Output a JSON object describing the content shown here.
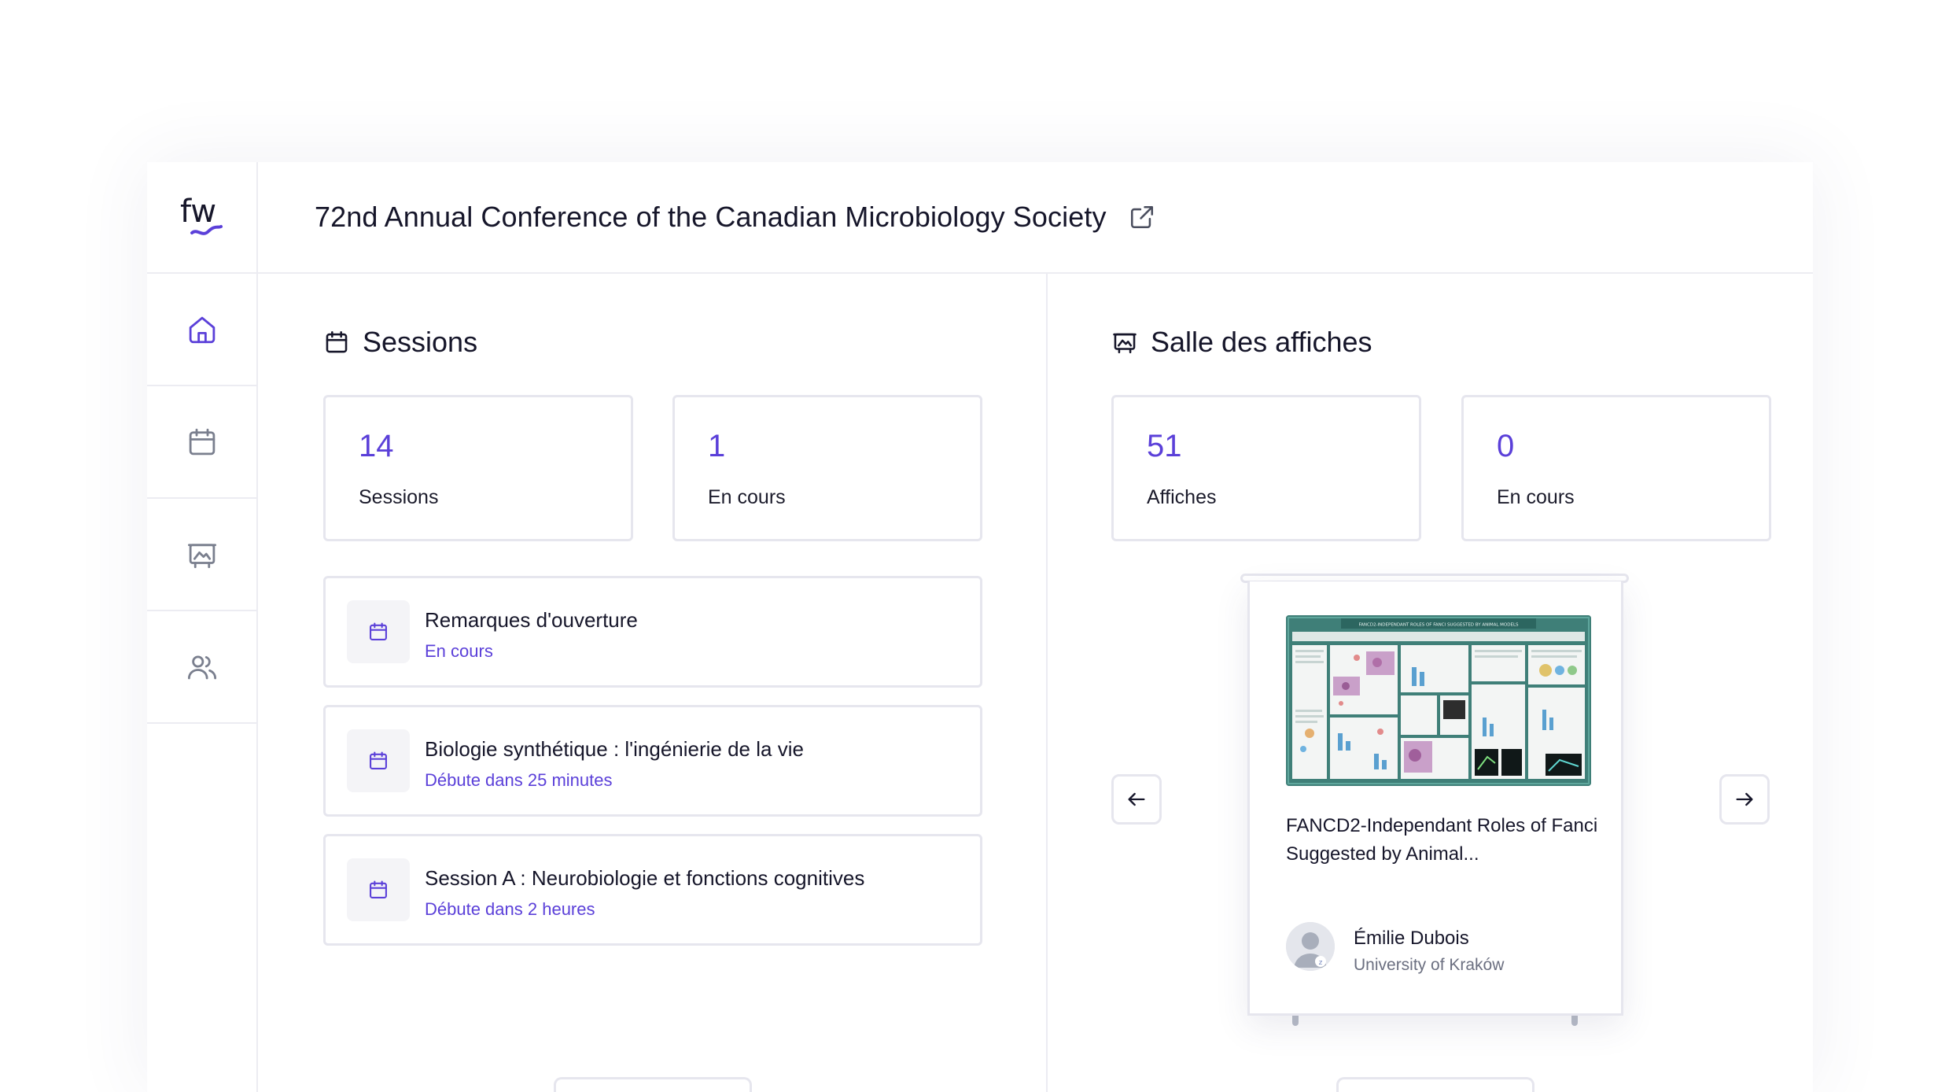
{
  "conference": {
    "title": "72nd Annual Conference of the Canadian Microbiology Society"
  },
  "brand": {
    "logo_text": "fw",
    "accent": "#5b40d9"
  },
  "sidebar": {
    "items": [
      {
        "name": "home",
        "icon": "home-icon",
        "active": true
      },
      {
        "name": "sessions",
        "icon": "calendar-icon",
        "active": false
      },
      {
        "name": "posters",
        "icon": "poster-icon",
        "active": false
      },
      {
        "name": "people",
        "icon": "users-icon",
        "active": false
      }
    ]
  },
  "sessions": {
    "title": "Sessions",
    "stats": [
      {
        "value": "14",
        "label": "Sessions"
      },
      {
        "value": "1",
        "label": "En cours"
      }
    ],
    "list": [
      {
        "title": "Remarques d'ouverture",
        "status": "En cours"
      },
      {
        "title": "Biologie synthétique : l'ingénierie de la vie",
        "status": "Débute dans 25 minutes"
      },
      {
        "title": "Session A : Neurobiologie et fonctions cognitives",
        "status": "Débute dans 2 heures"
      }
    ]
  },
  "posters": {
    "title": "Salle des affiches",
    "stats": [
      {
        "value": "51",
        "label": "Affiches"
      },
      {
        "value": "0",
        "label": "En cours"
      }
    ],
    "featured": {
      "thumbnail_heading": "FANCD2-INDEPENDANT ROLES OF FANCI SUGGESTED BY ANIMAL MODELS",
      "title": "FANCD2-Independant Roles of Fanci Suggested by Animal...",
      "author": "Émilie Dubois",
      "affiliation": "University of Kraków"
    }
  }
}
